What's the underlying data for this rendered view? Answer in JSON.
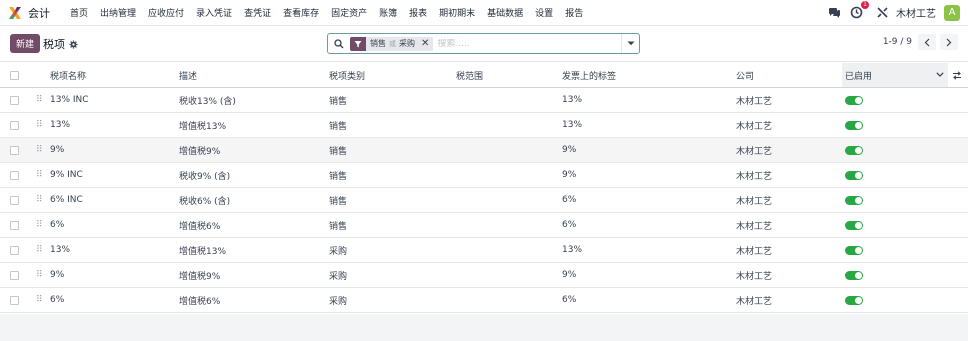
{
  "app": {
    "name": "会计"
  },
  "menu": [
    "首页",
    "出纳管理",
    "应收应付",
    "录入凭证",
    "查凭证",
    "查看库存",
    "固定资产",
    "账簿",
    "报表",
    "期初期末",
    "基础数据",
    "设置",
    "报告"
  ],
  "user": {
    "company": "木材工艺",
    "avatar_letter": "A",
    "notification_count": "1"
  },
  "control": {
    "new_label": "新建",
    "title": "税项",
    "search": {
      "facet_values": [
        "销售",
        "采购"
      ],
      "facet_or": "或",
      "placeholder": "搜索....."
    },
    "pager": {
      "value": "1-9 / 9"
    }
  },
  "table": {
    "headers": {
      "name": "税项名称",
      "description": "描述",
      "tax_type": "税项类别",
      "tax_scope": "税范围",
      "invoice_label": "发票上的标签",
      "company": "公司",
      "active": "已启用"
    },
    "rows": [
      {
        "name": "13% INC",
        "description": "税收13% (含)",
        "tax_type": "销售",
        "invoice_label": "13%",
        "company": "木材工艺",
        "active": true
      },
      {
        "name": "13%",
        "description": "增值税13%",
        "tax_type": "销售",
        "invoice_label": "13%",
        "company": "木材工艺",
        "active": true
      },
      {
        "name": "9%",
        "description": "增值税9%",
        "tax_type": "销售",
        "invoice_label": "9%",
        "company": "木材工艺",
        "active": true
      },
      {
        "name": "9% INC",
        "description": "税收9% (含)",
        "tax_type": "销售",
        "invoice_label": "9%",
        "company": "木材工艺",
        "active": true
      },
      {
        "name": "6% INC",
        "description": "税收6% (含)",
        "tax_type": "销售",
        "invoice_label": "6%",
        "company": "木材工艺",
        "active": true
      },
      {
        "name": "6%",
        "description": "增值税6%",
        "tax_type": "销售",
        "invoice_label": "6%",
        "company": "木材工艺",
        "active": true
      },
      {
        "name": "13%",
        "description": "增值税13%",
        "tax_type": "采购",
        "invoice_label": "13%",
        "company": "木材工艺",
        "active": true
      },
      {
        "name": "9%",
        "description": "增值税9%",
        "tax_type": "采购",
        "invoice_label": "9%",
        "company": "木材工艺",
        "active": true
      },
      {
        "name": "6%",
        "description": "增值税6%",
        "tax_type": "采购",
        "invoice_label": "6%",
        "company": "木材工艺",
        "active": true
      }
    ]
  },
  "colors": {
    "brand": "#714b67",
    "toggle_on": "#28a745",
    "search_border": "#6b9aa7",
    "badge": "#e11d48"
  }
}
